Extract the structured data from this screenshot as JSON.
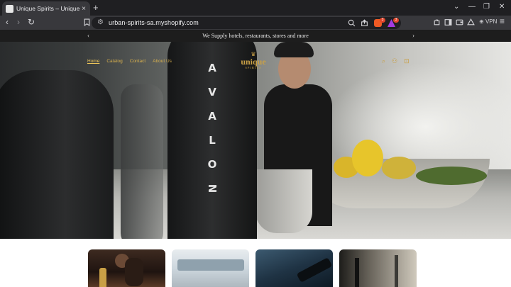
{
  "browser": {
    "tab_title": "Unique Spirits – Unique Spirits",
    "tab_close": "×",
    "new_tab": "+",
    "window_controls": {
      "tabs": "⌄",
      "minimize": "—",
      "maximize": "❐",
      "close": "✕"
    },
    "nav": {
      "back": "‹",
      "forward": "›",
      "reload": "↻"
    },
    "bookmark_icon": "bookmark-icon",
    "url": "urban-spirits-sa.myshopify.com",
    "zoom_icon": "zoom-icon",
    "share_icon": "share-icon",
    "shields_badge": "3",
    "rewards_badge": "3",
    "vpn_label": "VPN",
    "menu": "≡"
  },
  "announcement": {
    "text": "We Supply hotels, restaurants, stores and more",
    "prev": "‹",
    "next": "›"
  },
  "site": {
    "nav": [
      "Home",
      "Catalog",
      "Contact",
      "About Us"
    ],
    "logo_crown": "♛",
    "logo_name": "unique",
    "logo_sub": "SPIRITS",
    "icons": {
      "search": "⌕",
      "account": "⚇",
      "cart": "⊡"
    },
    "accent_color": "#c9a046"
  },
  "hero": {
    "bottle_letters": [
      "A",
      "V",
      "A",
      "L",
      "O",
      "N"
    ]
  },
  "collections": [
    {
      "name": "collection-card-1"
    },
    {
      "name": "collection-card-2"
    },
    {
      "name": "collection-card-3"
    },
    {
      "name": "collection-card-4"
    }
  ]
}
